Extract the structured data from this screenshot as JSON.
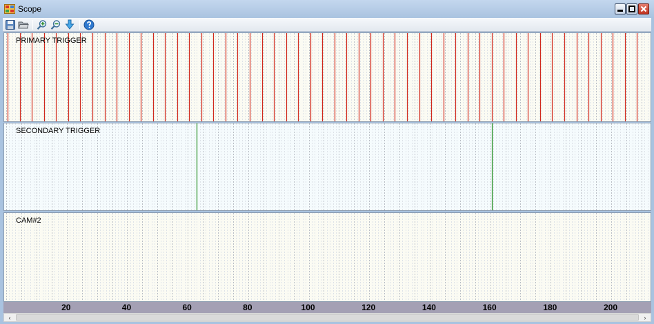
{
  "window": {
    "title": "Scope",
    "icon": "app-grid-icon"
  },
  "window_controls": {
    "minimize": "minimize-icon",
    "maximize": "maximize-icon",
    "close": "close-icon"
  },
  "toolbar": [
    {
      "name": "save-icon",
      "color": "#3a6ea5"
    },
    {
      "name": "open-folder-icon",
      "color": "#6a6a6a"
    },
    {
      "name": "zoom-in-icon",
      "color": "#2c8c2c"
    },
    {
      "name": "zoom-out-icon",
      "color": "#2c8c2c"
    },
    {
      "name": "download-icon",
      "color": "#3aa0e0"
    },
    {
      "name": "help-icon",
      "color": "#2b6fc2"
    }
  ],
  "channels": [
    {
      "label": "PRIMARY TRIGGER",
      "bg": "#fbfbf3",
      "pulse_color": "#d0281c",
      "pulses": [
        0.5,
        4.5,
        8.5,
        12.5,
        16.5,
        20.5,
        24.5,
        28.5,
        32.5,
        36.5,
        40.5,
        44.5,
        48.5,
        52.5,
        56.5,
        60.5,
        64.5,
        68.5,
        72.5,
        76.5,
        80.5,
        84.5,
        88.5,
        92.5,
        96.5,
        100.5,
        104.5,
        108.5,
        112.5,
        116.5,
        120.5,
        124.5,
        128.5,
        132.5,
        136.5,
        140.5,
        144.5,
        148.5,
        152.5,
        156.5,
        160.5,
        164.5,
        168.5,
        172.5,
        176.5,
        180.5,
        184.5,
        188.5,
        192.5,
        196.5,
        200.5,
        204.5,
        208.5
      ]
    },
    {
      "label": "SECONDARY TRIGGER",
      "bg": "#f5fbfd",
      "pulse_color": "#1e8a1e",
      "pulses": [
        63,
        160.5
      ]
    },
    {
      "label": "CAM#2",
      "bg": "#fbfbf3",
      "pulse_color": "#1e8a1e",
      "pulses": []
    }
  ],
  "axis": {
    "min": -0.7,
    "max": 213,
    "ticks": [
      20,
      40,
      60,
      80,
      100,
      120,
      140,
      160,
      180,
      200
    ]
  },
  "scrollbar": {
    "left_arrow": "‹",
    "right_arrow": "›"
  }
}
